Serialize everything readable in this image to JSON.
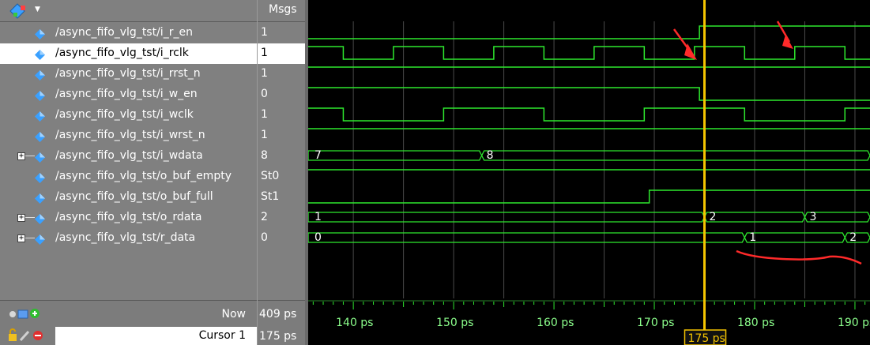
{
  "toolbar": {
    "dropdown_arrow": "▼",
    "msgs_header": "Msgs"
  },
  "signals": [
    {
      "name": "/async_fifo_vlg_tst/i_r_en",
      "value": "1",
      "expandable": false,
      "selected": false
    },
    {
      "name": "/async_fifo_vlg_tst/i_rclk",
      "value": "1",
      "expandable": false,
      "selected": true
    },
    {
      "name": "/async_fifo_vlg_tst/i_rrst_n",
      "value": "1",
      "expandable": false,
      "selected": false
    },
    {
      "name": "/async_fifo_vlg_tst/i_w_en",
      "value": "0",
      "expandable": false,
      "selected": false
    },
    {
      "name": "/async_fifo_vlg_tst/i_wclk",
      "value": "1",
      "expandable": false,
      "selected": false
    },
    {
      "name": "/async_fifo_vlg_tst/i_wrst_n",
      "value": "1",
      "expandable": false,
      "selected": false
    },
    {
      "name": "/async_fifo_vlg_tst/i_wdata",
      "value": "8",
      "expandable": true,
      "selected": false
    },
    {
      "name": "/async_fifo_vlg_tst/o_buf_empty",
      "value": "St0",
      "expandable": false,
      "selected": false
    },
    {
      "name": "/async_fifo_vlg_tst/o_buf_full",
      "value": "St1",
      "expandable": false,
      "selected": false
    },
    {
      "name": "/async_fifo_vlg_tst/o_rdata",
      "value": "2",
      "expandable": true,
      "selected": false
    },
    {
      "name": "/async_fifo_vlg_tst/r_data",
      "value": "0",
      "expandable": true,
      "selected": false
    }
  ],
  "status": {
    "now_label": "Now",
    "now_value": "409 ps",
    "cursor_label": "Cursor 1",
    "cursor_value": "175 ps"
  },
  "timeline": {
    "start_ps": 135.5,
    "end_ps": 191.5,
    "ticks_ps": [
      140,
      150,
      160,
      170,
      180,
      190
    ],
    "tick_labels": [
      "140 ps",
      "150 ps",
      "160 ps",
      "170 ps",
      "180 ps",
      "190 ps"
    ],
    "cursor_ps": 175,
    "cursor_label": "175 ps"
  },
  "waves": [
    {
      "kind": "bit",
      "initial": 0,
      "toggles_ps": [
        174.5
      ]
    },
    {
      "kind": "bit",
      "initial": 1,
      "toggles_ps": [
        139,
        144,
        149,
        154,
        159,
        164,
        169,
        174,
        179,
        184,
        189
      ]
    },
    {
      "kind": "bit",
      "initial": 1,
      "toggles_ps": []
    },
    {
      "kind": "bit",
      "initial": 1,
      "toggles_ps": [
        174.5
      ]
    },
    {
      "kind": "bit",
      "initial": 1,
      "toggles_ps": [
        139,
        149,
        159,
        169,
        179,
        189
      ]
    },
    {
      "kind": "bit",
      "initial": 1,
      "toggles_ps": []
    },
    {
      "kind": "bus",
      "segments": [
        {
          "from_ps": 135.5,
          "value": "7"
        },
        {
          "from_ps": 152.8,
          "value": "8"
        }
      ]
    },
    {
      "kind": "bit",
      "initial": 1,
      "toggles_ps": []
    },
    {
      "kind": "bit",
      "initial": 0,
      "toggles_ps": [
        169.5
      ]
    },
    {
      "kind": "bus",
      "segments": [
        {
          "from_ps": 135.5,
          "value": "1"
        },
        {
          "from_ps": 175,
          "value": "2"
        },
        {
          "from_ps": 185,
          "value": "3"
        }
      ]
    },
    {
      "kind": "bus",
      "segments": [
        {
          "from_ps": 135.5,
          "value": "0"
        },
        {
          "from_ps": 179,
          "value": "1"
        },
        {
          "from_ps": 189,
          "value": "2"
        }
      ]
    }
  ],
  "colors": {
    "wave": "#2ee82e",
    "grid": "#4a4a4a",
    "cursor": "#f5c400",
    "annotation": "#ff2a2a",
    "panel": "#808080"
  }
}
